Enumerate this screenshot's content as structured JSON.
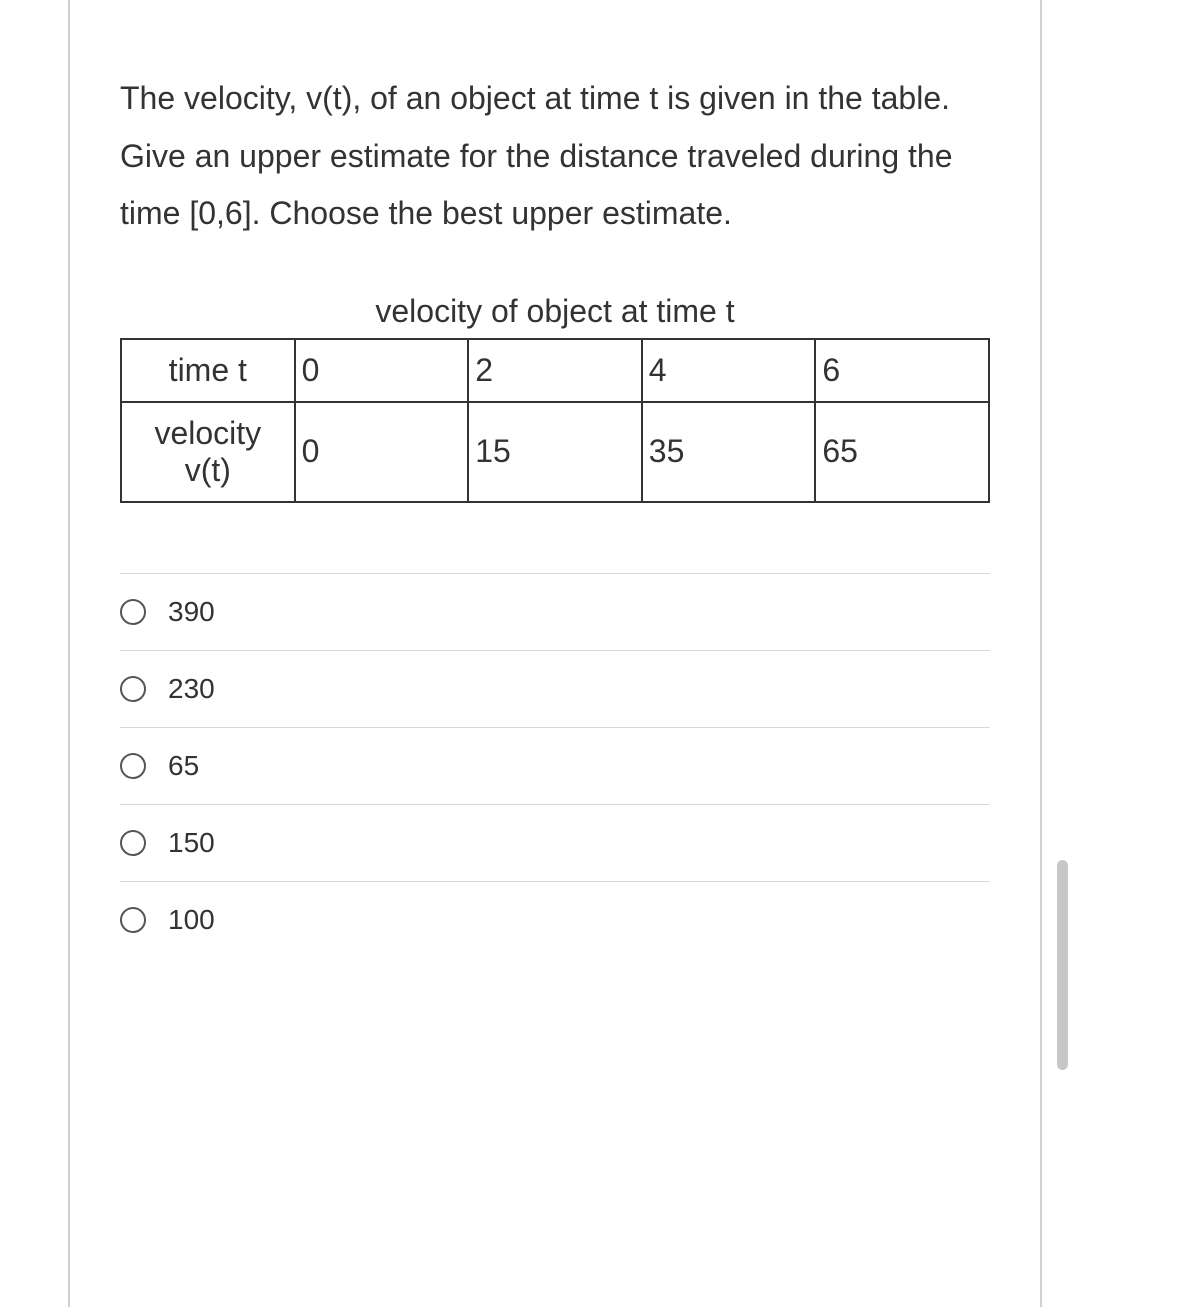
{
  "question": {
    "text": "The velocity, v(t),  of an object at time t is given in the table.  Give an upper estimate for the distance traveled during the time [0,6]. Choose the best upper estimate."
  },
  "table": {
    "caption": "velocity of object at time t",
    "rows": [
      {
        "label": "time t",
        "cells": [
          "0",
          "2",
          "4",
          "6"
        ]
      },
      {
        "label": "velocity v(t)",
        "cells": [
          "0",
          "15",
          "35",
          "65"
        ]
      }
    ]
  },
  "options": [
    {
      "label": "390"
    },
    {
      "label": "230"
    },
    {
      "label": "65"
    },
    {
      "label": "150"
    },
    {
      "label": "100"
    }
  ]
}
